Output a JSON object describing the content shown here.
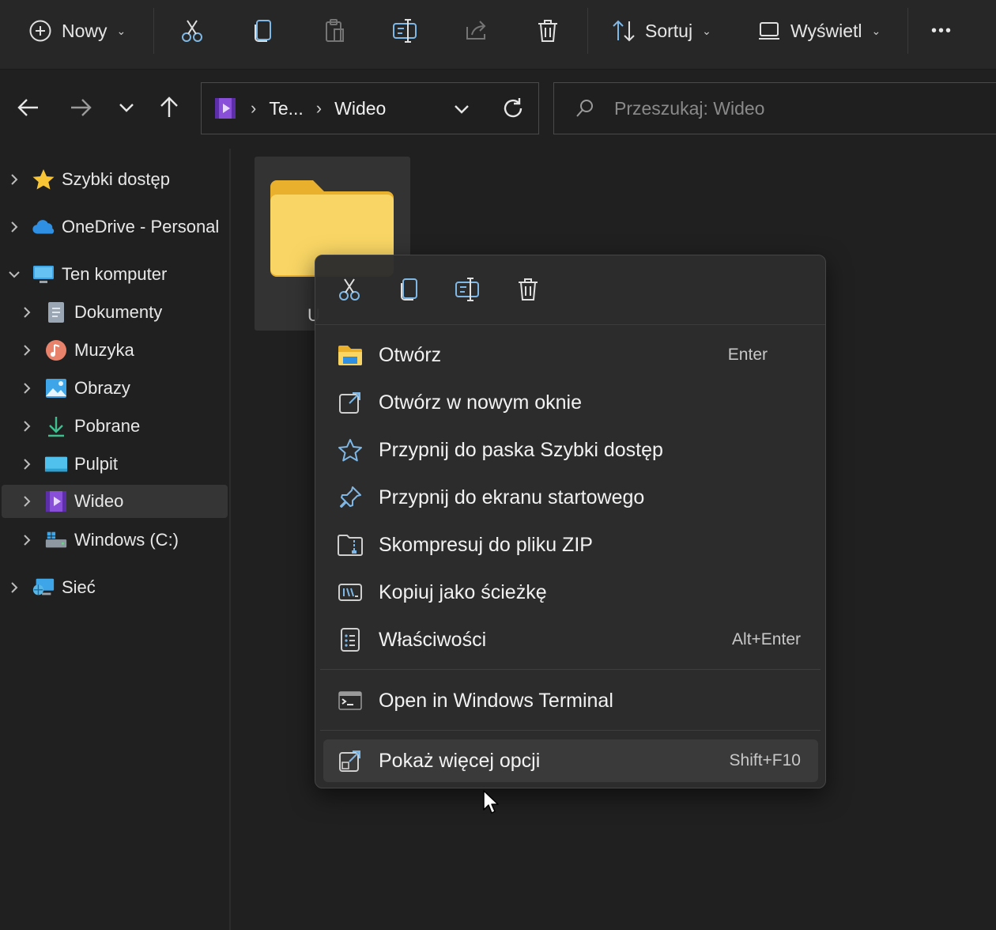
{
  "toolbar": {
    "new_label": "Nowy",
    "sort_label": "Sortuj",
    "view_label": "Wyświetl",
    "more_label": "•••"
  },
  "address": {
    "crumbs": [
      "Te...",
      "Wideo"
    ],
    "search_placeholder": "Przeszukaj: Wideo"
  },
  "sidebar": {
    "items": [
      {
        "label": "Szybki dostęp",
        "icon": "star-icon"
      },
      {
        "label": "OneDrive - Personal",
        "icon": "cloud-icon"
      },
      {
        "label": "Ten komputer",
        "icon": "computer-icon"
      },
      {
        "label": "Dokumenty",
        "icon": "documents-icon"
      },
      {
        "label": "Muzyka",
        "icon": "music-icon"
      },
      {
        "label": "Obrazy",
        "icon": "pictures-icon"
      },
      {
        "label": "Pobrane",
        "icon": "download-icon"
      },
      {
        "label": "Pulpit",
        "icon": "desktop-icon"
      },
      {
        "label": "Wideo",
        "icon": "video-icon"
      },
      {
        "label": "Windows (C:)",
        "icon": "drive-icon"
      },
      {
        "label": "Sieć",
        "icon": "network-icon"
      }
    ],
    "selected": "Wideo"
  },
  "content": {
    "folder_label_peek": "U"
  },
  "context_menu": {
    "items": [
      {
        "label": "Otwórz",
        "shortcut": "Enter",
        "icon": "folder-open-icon"
      },
      {
        "label": "Otwórz w nowym oknie",
        "shortcut": "",
        "icon": "open-new-window-icon"
      },
      {
        "label": "Przypnij do paska Szybki dostęp",
        "shortcut": "",
        "icon": "star-outline-icon"
      },
      {
        "label": "Przypnij do ekranu startowego",
        "shortcut": "",
        "icon": "pin-icon"
      },
      {
        "label": "Skompresuj do pliku ZIP",
        "shortcut": "",
        "icon": "zip-icon"
      },
      {
        "label": "Kopiuj jako ścieżkę",
        "shortcut": "",
        "icon": "copy-path-icon"
      },
      {
        "label": "Właściwości",
        "shortcut": "Alt+Enter",
        "icon": "properties-icon"
      },
      {
        "label": "Open in Windows Terminal",
        "shortcut": "",
        "icon": "terminal-icon"
      },
      {
        "label": "Pokaż więcej opcji",
        "shortcut": "Shift+F10",
        "icon": "more-options-icon"
      }
    ]
  },
  "colors": {
    "background": "#202020",
    "toolbar": "#272727",
    "menu": "#2c2c2c",
    "folder": "#f5c842",
    "accent_blue": "#4aa8e8"
  }
}
